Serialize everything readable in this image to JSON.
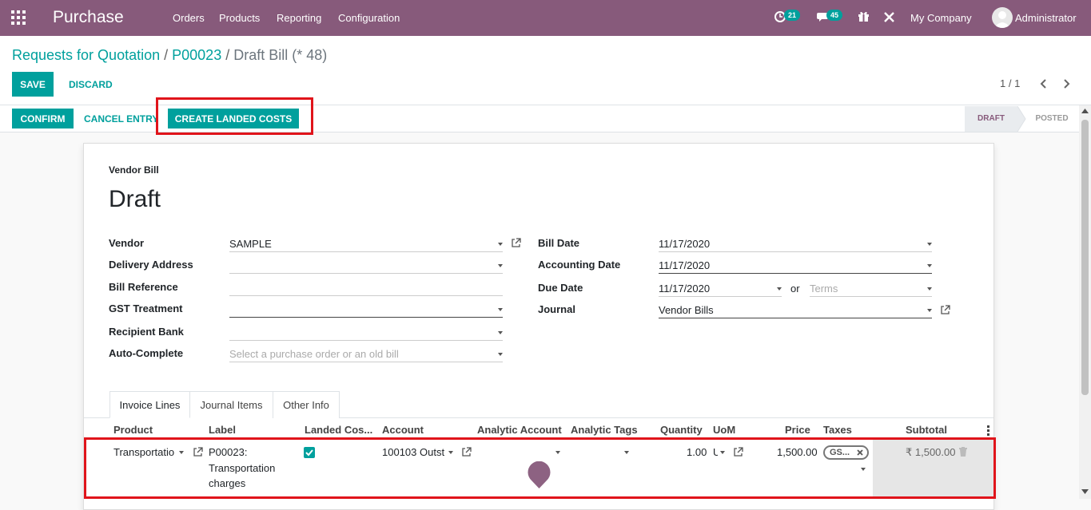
{
  "navbar": {
    "app_name": "Purchase",
    "menu": [
      "Orders",
      "Products",
      "Reporting",
      "Configuration"
    ],
    "activity_count": "21",
    "message_count": "45",
    "company": "My Company",
    "user": "Administrator"
  },
  "breadcrumb": {
    "items": [
      "Requests for Quotation",
      "P00023"
    ],
    "current": "Draft Bill (* 48)"
  },
  "toolbar": {
    "save_label": "SAVE",
    "discard_label": "DISCARD",
    "pager": "1 / 1"
  },
  "header_buttons": {
    "confirm": "CONFIRM",
    "cancel_entry": "CANCEL ENTRY",
    "create_landed_costs": "CREATE LANDED COSTS"
  },
  "statusbar": {
    "stages": [
      "DRAFT",
      "POSTED"
    ],
    "active": "DRAFT"
  },
  "form": {
    "doc_type": "Vendor Bill",
    "state_title": "Draft",
    "left_fields": [
      {
        "label": "Vendor",
        "value": "SAMPLE",
        "placeholder": ""
      },
      {
        "label": "Delivery Address",
        "value": "",
        "placeholder": ""
      },
      {
        "label": "Bill Reference",
        "value": "",
        "placeholder": ""
      },
      {
        "label": "GST Treatment",
        "value": "",
        "placeholder": ""
      },
      {
        "label": "Recipient Bank",
        "value": "",
        "placeholder": ""
      },
      {
        "label": "Auto-Complete",
        "value": "",
        "placeholder": "Select a purchase order or an old bill"
      }
    ],
    "right_fields": [
      {
        "label": "Bill Date",
        "value": "11/17/2020"
      },
      {
        "label": "Accounting Date",
        "value": "11/17/2020"
      },
      {
        "label": "Due Date",
        "value": "11/17/2020"
      },
      {
        "label": "Journal",
        "value": "Vendor Bills"
      }
    ],
    "due_date_or": "or",
    "terms_placeholder": "Terms"
  },
  "notebook": {
    "tabs": [
      "Invoice Lines",
      "Journal Items",
      "Other Info"
    ],
    "active_tab": "Invoice Lines",
    "columns": [
      "Product",
      "Label",
      "Landed Cos...",
      "Account",
      "Analytic Account",
      "Analytic Tags",
      "Quantity",
      "UoM",
      "Price",
      "Taxes",
      "Subtotal"
    ],
    "rows": [
      {
        "product": "Transportatio",
        "label_lines": [
          "P00023:",
          "Transportation",
          "charges"
        ],
        "landed_cost": true,
        "account": "100103 Outst",
        "analytic_account": "",
        "analytic_tags": "",
        "quantity": "1.00",
        "uom": "U",
        "price": "1,500.00",
        "tax": "GS...",
        "subtotal": "₹ 1,500.00"
      }
    ]
  },
  "colors": {
    "brand": "#875a7b",
    "accent": "#00a09d",
    "highlight": "#e0141b"
  }
}
